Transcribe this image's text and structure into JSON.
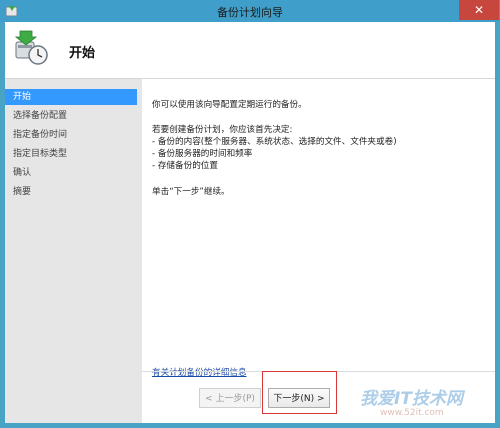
{
  "window": {
    "title": "备份计划向导",
    "close_label": "✕"
  },
  "header": {
    "title": "开始",
    "icon": "backup-wizard-icon"
  },
  "sidebar": {
    "items": [
      {
        "label": "开始",
        "active": true
      },
      {
        "label": "选择备份配置",
        "active": false
      },
      {
        "label": "指定备份时间",
        "active": false
      },
      {
        "label": "指定目标类型",
        "active": false
      },
      {
        "label": "确认",
        "active": false
      },
      {
        "label": "摘要",
        "active": false
      }
    ]
  },
  "main": {
    "intro": "你可以使用该向导配置定期运行的备份。",
    "decide_heading": "若要创建备份计划，你应该首先决定:",
    "bullets": [
      "- 备份的内容(整个服务器、系统状态、选择的文件、文件夹或卷)",
      "- 备份服务器的时间和频率",
      "- 存储备份的位置"
    ],
    "continue_text": "单击“下一步”继续。",
    "more_info_link": "有关计划备份的详细信息"
  },
  "buttons": {
    "prev": "< 上一步(P)",
    "next": "下一步(N) >"
  },
  "watermark": {
    "text": "我爱IT技术网",
    "url": "www.52it.com"
  },
  "colors": {
    "titlebar": "#3f9fca",
    "close": "#c7463d",
    "sidebar_active": "#3399ff",
    "link": "#1a4aa8",
    "highlight": "#d93636"
  }
}
